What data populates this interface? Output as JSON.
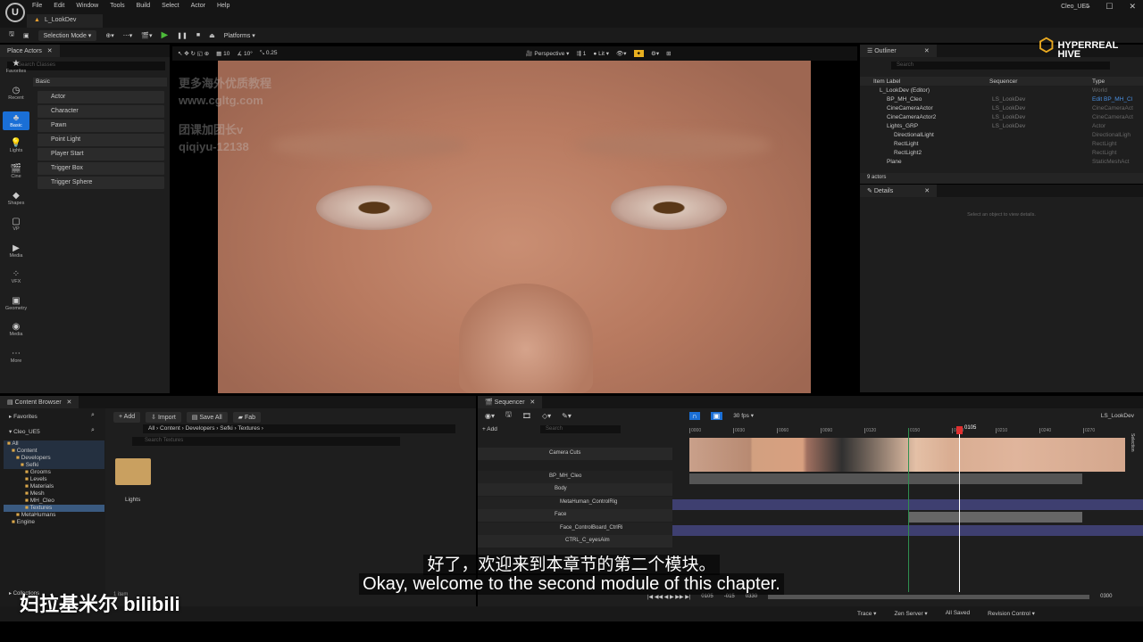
{
  "menubar": {
    "items": [
      "File",
      "Edit",
      "Window",
      "Tools",
      "Build",
      "Select",
      "Actor",
      "Help"
    ],
    "level_tab": "L_LookDev",
    "project": "Cleo_UE5"
  },
  "toolbar": {
    "selection_mode": "Selection Mode",
    "platforms": "Platforms"
  },
  "place_actors": {
    "title": "Place Actors",
    "search_placeholder": "Search Classes",
    "categories": [
      "Favorites",
      "Recent",
      "Basic",
      "Lights",
      "Cine",
      "Shapes",
      "VP",
      "Media",
      "VFX",
      "Geometry",
      "Media",
      "More"
    ],
    "section": "Basic",
    "items": [
      "Actor",
      "Character",
      "Pawn",
      "Point Light",
      "Player Start",
      "Trigger Box",
      "Trigger Sphere"
    ]
  },
  "viewport": {
    "perspective": "Perspective",
    "lit": "Lit",
    "grid": "10",
    "angle": "10°",
    "scale": "0.25",
    "cam_speed": "1",
    "snap": "1"
  },
  "watermark": {
    "line1": "更多海外优质教程",
    "line2": "www.cgltg.com",
    "line3": "团课加团长v",
    "line4": "qiqiyu-12138",
    "logo": "HYPERREAL HIVE",
    "bilibili": "妇拉基米尔 bilibili"
  },
  "outliner": {
    "title": "Outliner",
    "search_placeholder": "Search",
    "columns": [
      "Item Label",
      "Sequencer",
      "Type"
    ],
    "rows": [
      {
        "label": "L_LookDev (Editor)",
        "seq": "",
        "type": "World",
        "indent": 0
      },
      {
        "label": "BP_MH_Cleo",
        "seq": "LS_LookDev",
        "type": "Edit BP_MH_Cl",
        "indent": 1
      },
      {
        "label": "CineCameraActor",
        "seq": "LS_LookDev",
        "type": "CineCameraAct",
        "indent": 1
      },
      {
        "label": "CineCameraActor2",
        "seq": "LS_LookDev",
        "type": "CineCameraAct",
        "indent": 1
      },
      {
        "label": "Lights_GRP",
        "seq": "LS_LookDev",
        "type": "Actor",
        "indent": 1
      },
      {
        "label": "DirectionalLight",
        "seq": "",
        "type": "DirectionalLigh",
        "indent": 2
      },
      {
        "label": "RectLight",
        "seq": "",
        "type": "RectLight",
        "indent": 2
      },
      {
        "label": "RectLight2",
        "seq": "",
        "type": "RectLight",
        "indent": 2
      },
      {
        "label": "Plane",
        "seq": "",
        "type": "StaticMeshAct",
        "indent": 1
      }
    ],
    "count": "9 actors"
  },
  "details": {
    "title": "Details",
    "empty": "Select an object to view details."
  },
  "content_browser": {
    "title": "Content Browser",
    "favorites": "Favorites",
    "project": "Cleo_UE5",
    "add": "Add",
    "import": "Import",
    "save_all": "Save All",
    "fab": "Fab",
    "breadcrumb": [
      "All",
      "Content",
      "Developers",
      "Sefki",
      "Textures"
    ],
    "search_placeholder": "Search Textures",
    "tree": [
      {
        "l": "All",
        "d": 0
      },
      {
        "l": "Content",
        "d": 1
      },
      {
        "l": "Developers",
        "d": 2
      },
      {
        "l": "Sefki",
        "d": 3
      },
      {
        "l": "Grooms",
        "d": 4
      },
      {
        "l": "Levels",
        "d": 4
      },
      {
        "l": "Materials",
        "d": 4
      },
      {
        "l": "Mesh",
        "d": 4
      },
      {
        "l": "MH_Cleo",
        "d": 4
      },
      {
        "l": "Textures",
        "d": 4
      },
      {
        "l": "MetaHumans",
        "d": 2
      },
      {
        "l": "Engine",
        "d": 1
      }
    ],
    "asset": "Lights",
    "collections": "Collections",
    "items_count": "1 item"
  },
  "sequencer": {
    "title": "Sequencer",
    "add": "Add",
    "search_placeholder": "Search",
    "fps": "30 fps",
    "sequence": "LS_LookDev",
    "playhead": "0105",
    "current_frame": "0105",
    "start": "-015",
    "end": "0330",
    "view_end": "0300",
    "ticks": [
      "0000",
      "0030",
      "0060",
      "0090",
      "0120",
      "0150",
      "0180",
      "0210",
      "0240",
      "0270"
    ],
    "tracks": [
      "Camera Cuts",
      "BP_MH_Cleo",
      "Body",
      "MetaHuman_ControlRig",
      "Face",
      "Face_ControlBoard_CtrlRi",
      "CTRL_C_eyesAim"
    ],
    "selection": "Selection"
  },
  "subtitles": {
    "zh": "好了，欢迎来到本章节的第二个模块。",
    "en": "Okay, welcome to the second module of this chapter."
  },
  "statusbar": {
    "trace": "Trace",
    "zen": "Zen Server",
    "saved": "All Saved",
    "revision": "Revision Control"
  }
}
